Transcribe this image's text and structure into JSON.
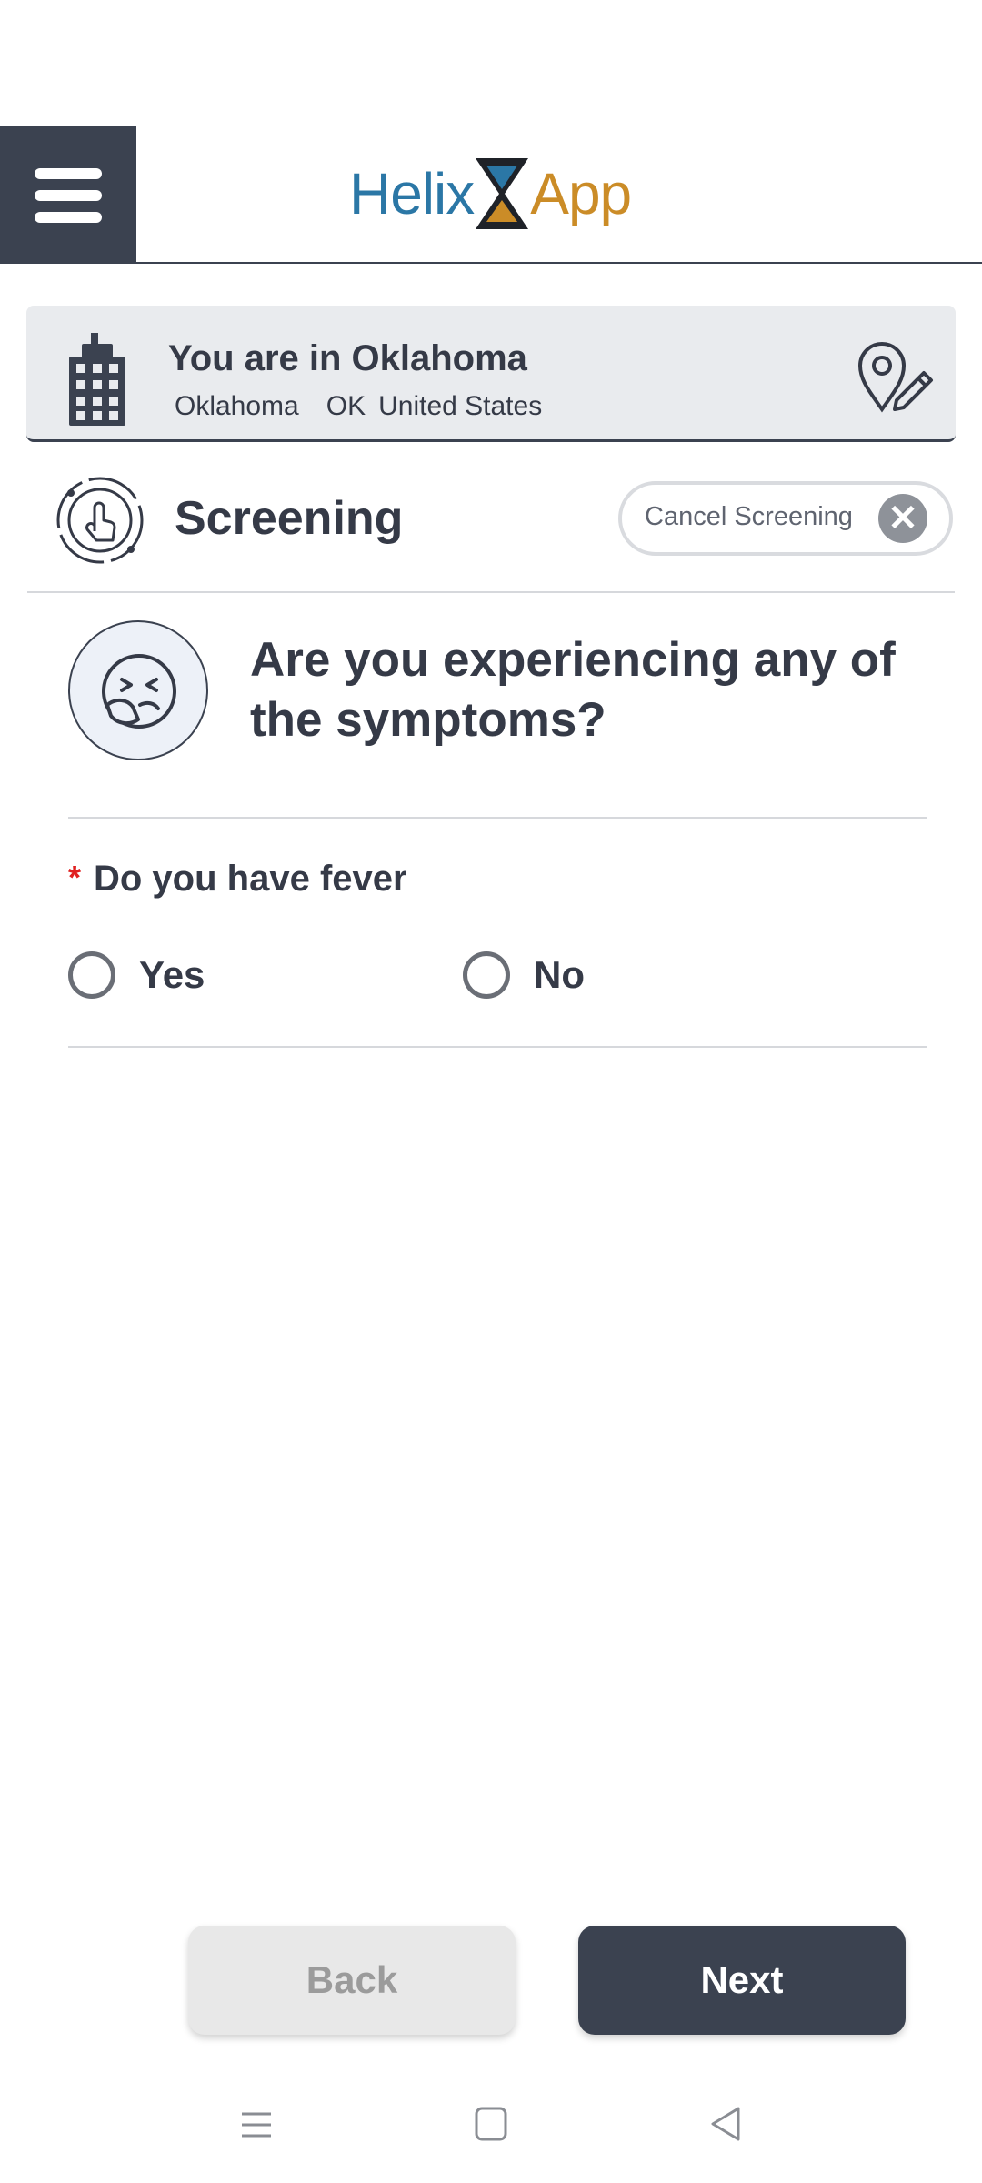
{
  "header": {
    "logo_left": "Helix",
    "logo_right": "App",
    "menu_icon": "hamburger-icon"
  },
  "location": {
    "title": "You are in Oklahoma",
    "city": "Oklahoma",
    "state": "OK",
    "country": "United States",
    "building_icon": "building-icon",
    "edit_icon": "location-edit-icon"
  },
  "screening": {
    "title": "Screening",
    "cancel_label": "Cancel Screening",
    "cancel_icon": "close-circle-icon"
  },
  "question": {
    "text": "Are you experiencing any of the symptoms?",
    "icon": "sneezing-face-icon",
    "fields": [
      {
        "required_mark": "*",
        "label": "Do you have fever",
        "options": [
          "Yes",
          "No"
        ]
      }
    ]
  },
  "footer": {
    "back_label": "Back",
    "next_label": "Next"
  },
  "colors": {
    "primary_dark": "#3b4250",
    "logo_blue": "#2b77a6",
    "logo_gold": "#cb8c27",
    "required_red": "#e02020"
  }
}
